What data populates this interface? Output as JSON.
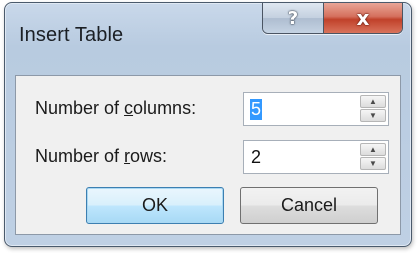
{
  "window": {
    "title": "Insert Table",
    "help_label": "?",
    "close_label": "x"
  },
  "fields": {
    "columns": {
      "label_pre": "Number of ",
      "label_key": "c",
      "label_post": "olumns:",
      "value": "5"
    },
    "rows": {
      "label_pre": "Number of ",
      "label_key": "r",
      "label_post": "ows:",
      "value": "2"
    }
  },
  "buttons": {
    "ok_label": "OK",
    "cancel_label": "Cancel"
  },
  "icons": {
    "spin_up": "▲",
    "spin_down": "▼"
  }
}
